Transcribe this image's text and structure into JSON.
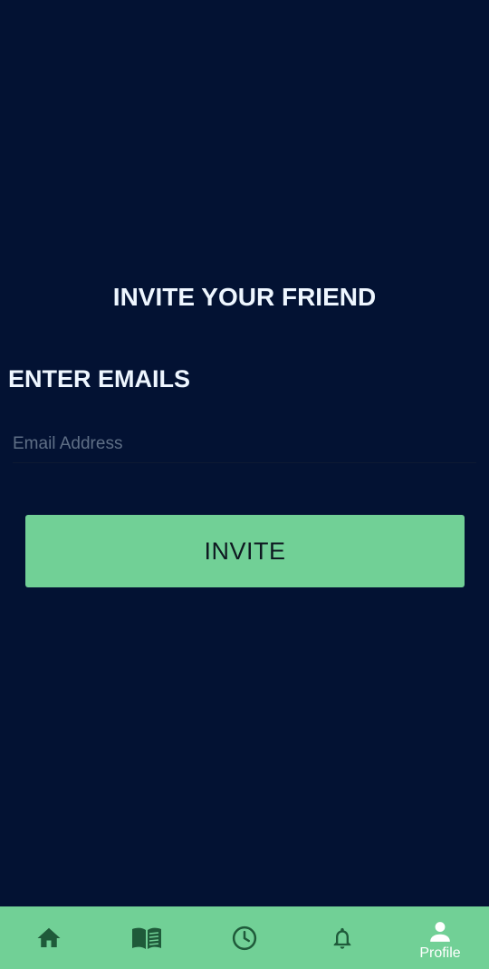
{
  "page": {
    "title": "INVITE YOUR FRIEND",
    "section_label": "ENTER EMAILS"
  },
  "email_field": {
    "placeholder": "Email Address",
    "value": ""
  },
  "invite_button": {
    "label": "INVITE"
  },
  "bottom_nav": {
    "items": [
      {
        "icon": "home-icon",
        "label": "",
        "active": false
      },
      {
        "icon": "book-icon",
        "label": "",
        "active": false
      },
      {
        "icon": "clock-icon",
        "label": "",
        "active": false
      },
      {
        "icon": "bell-icon",
        "label": "",
        "active": false
      },
      {
        "icon": "person-icon",
        "label": "Profile",
        "active": true
      }
    ]
  },
  "colors": {
    "background": "#031233",
    "accent": "#71d096",
    "nav_icon": "#1f5a3a",
    "heading_text": "#eef6ff",
    "placeholder_text": "#5f6f86"
  }
}
